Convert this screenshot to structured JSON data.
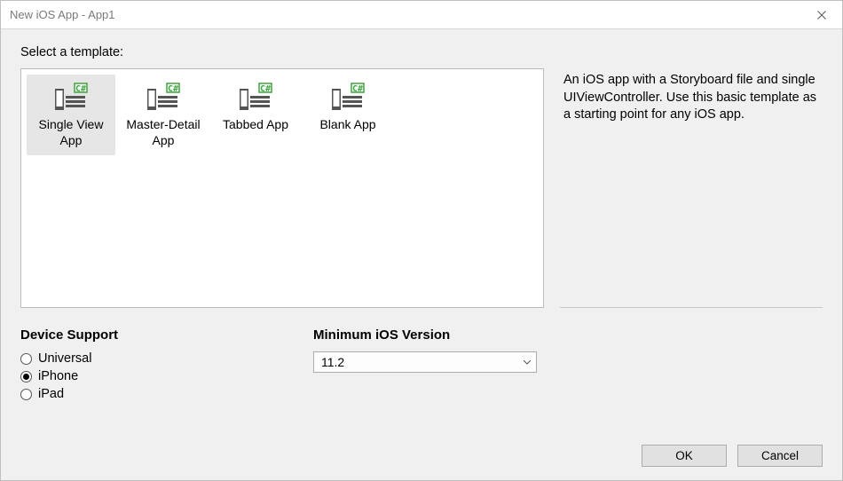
{
  "window": {
    "title": "New iOS App - App1"
  },
  "prompt": "Select a template:",
  "templates": [
    {
      "label": "Single View App",
      "selected": true
    },
    {
      "label": "Master-Detail App",
      "selected": false
    },
    {
      "label": "Tabbed App",
      "selected": false
    },
    {
      "label": "Blank App",
      "selected": false
    }
  ],
  "description": "An iOS app with a Storyboard file and single UIViewController. Use this basic template as a starting point for any iOS app.",
  "device_support": {
    "heading": "Device Support",
    "options": [
      {
        "label": "Universal",
        "selected": false
      },
      {
        "label": "iPhone",
        "selected": true
      },
      {
        "label": "iPad",
        "selected": false
      }
    ]
  },
  "min_ios": {
    "heading": "Minimum iOS Version",
    "value": "11.2"
  },
  "buttons": {
    "ok": "OK",
    "cancel": "Cancel"
  }
}
